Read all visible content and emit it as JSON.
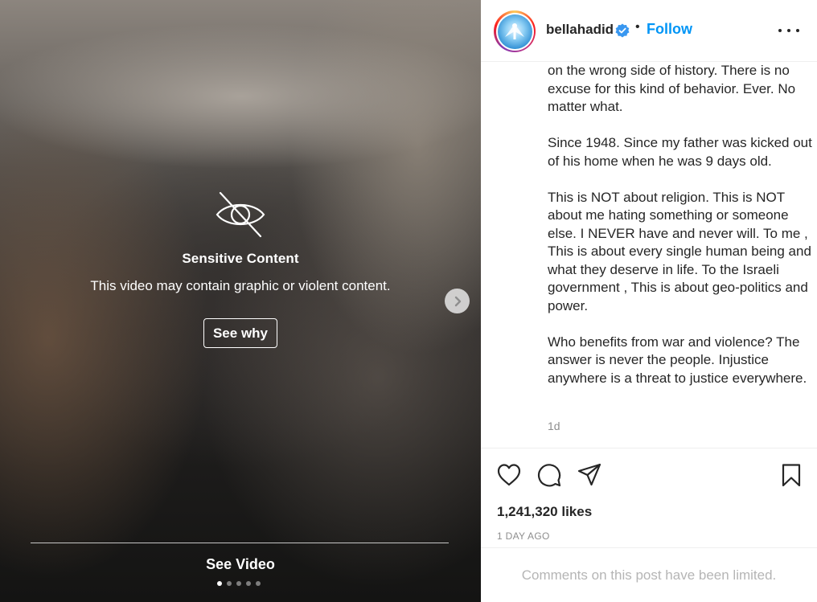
{
  "media": {
    "sensitive_title": "Sensitive Content",
    "sensitive_description": "This video may contain graphic or violent content.",
    "see_why_label": "See why",
    "see_video_label": "See Video",
    "carousel_count": 5,
    "carousel_active_index": 0,
    "icons": {
      "hidden": "eye-slash-icon",
      "next": "chevron-right-icon"
    }
  },
  "post": {
    "username": "bellahadid",
    "verified": true,
    "separator": "•",
    "follow_label": "Follow",
    "caption_paragraphs": [
      "on the wrong side of history. There is no excuse for this kind of behavior. Ever. No matter what.",
      "Since 1948. Since my father was kicked out of his home when he was 9 days old.",
      "This is NOT about religion. This is NOT about me hating something or someone else. I NEVER have and never will. To me , This is about every single human being and what they deserve in life. To the Israeli government , This is about geo-politics and power.",
      "Who benefits from war and violence? The answer is never the people. Injustice anywhere is a threat to justice everywhere."
    ],
    "caption_age": "1d",
    "likes": "1,241,320 likes",
    "posted_ago": "1 DAY AGO",
    "comments_notice": "Comments on this post have been limited.",
    "icons": {
      "more": "more-options-icon",
      "like": "heart-icon",
      "comment": "comment-icon",
      "share": "share-icon",
      "save": "bookmark-icon"
    },
    "accent_color": "#0095f6"
  }
}
